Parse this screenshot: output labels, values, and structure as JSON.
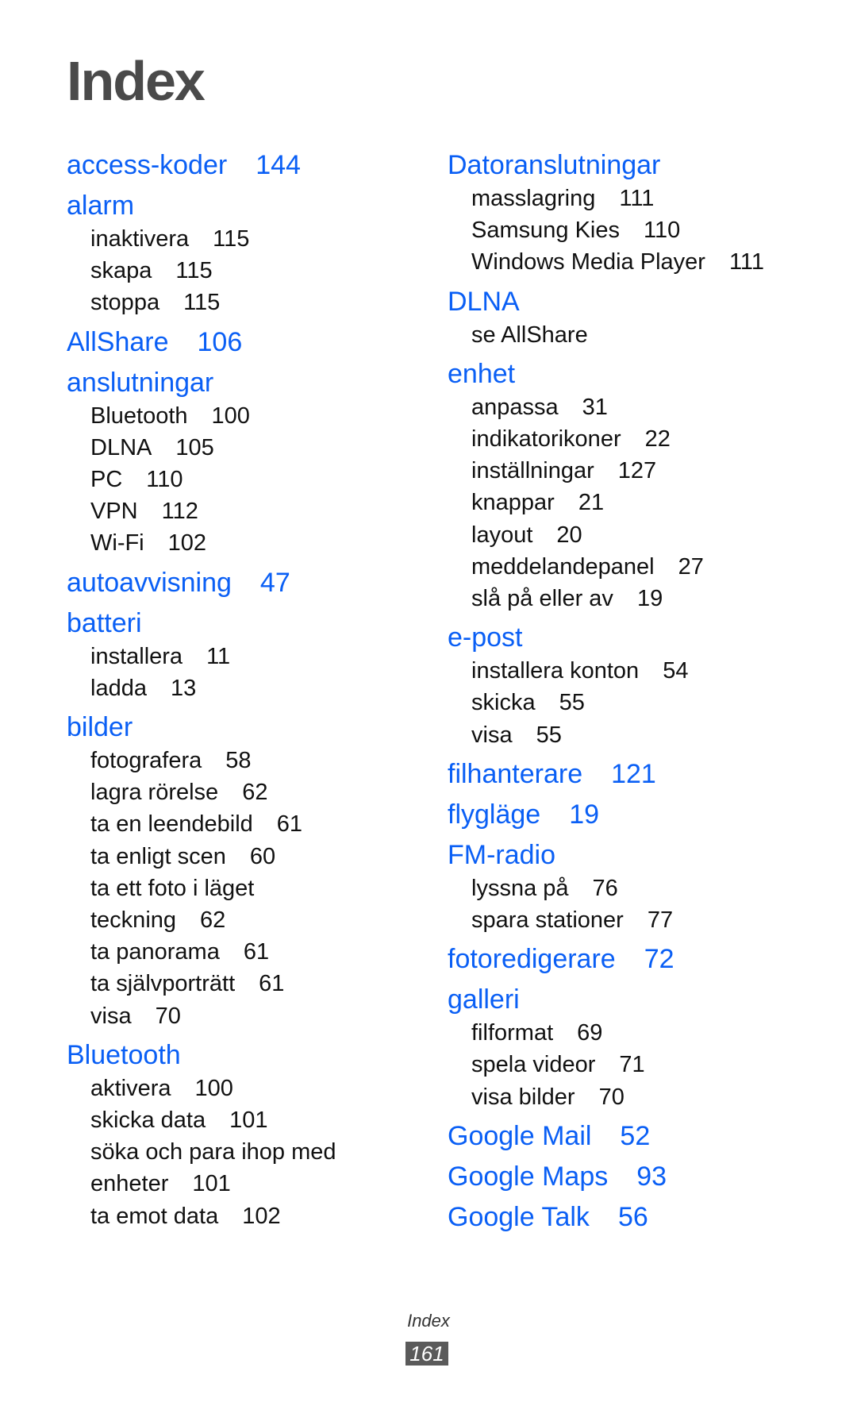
{
  "title": "Index",
  "columns": [
    {
      "entries": [
        {
          "term": "access-koder",
          "page": "144",
          "subs": []
        },
        {
          "term": "alarm",
          "page": "",
          "subs": [
            {
              "text": "inaktivera",
              "page": "115"
            },
            {
              "text": "skapa",
              "page": "115"
            },
            {
              "text": "stoppa",
              "page": "115"
            }
          ]
        },
        {
          "term": "AllShare",
          "page": "106",
          "subs": []
        },
        {
          "term": "anslutningar",
          "page": "",
          "subs": [
            {
              "text": "Bluetooth",
              "page": "100"
            },
            {
              "text": "DLNA",
              "page": "105"
            },
            {
              "text": "PC",
              "page": "110"
            },
            {
              "text": "VPN",
              "page": "112"
            },
            {
              "text": "Wi-Fi",
              "page": "102"
            }
          ]
        },
        {
          "term": "autoavvisning",
          "page": "47",
          "subs": []
        },
        {
          "term": "batteri",
          "page": "",
          "subs": [
            {
              "text": "installera",
              "page": "11"
            },
            {
              "text": "ladda",
              "page": "13"
            }
          ]
        },
        {
          "term": "bilder",
          "page": "",
          "subs": [
            {
              "text": "fotografera",
              "page": "58"
            },
            {
              "text": "lagra rörelse",
              "page": "62"
            },
            {
              "text": "ta en leendebild",
              "page": "61"
            },
            {
              "text": "ta enligt scen",
              "page": "60"
            },
            {
              "text": "ta ett foto i läget",
              "cont": "teckning",
              "page": "62"
            },
            {
              "text": "ta panorama",
              "page": "61"
            },
            {
              "text": "ta självporträtt",
              "page": "61"
            },
            {
              "text": "visa",
              "page": "70"
            }
          ]
        },
        {
          "term": "Bluetooth",
          "page": "",
          "subs": [
            {
              "text": "aktivera",
              "page": "100"
            },
            {
              "text": "skicka data",
              "page": "101"
            },
            {
              "text": "söka och para ihop med",
              "cont": "enheter",
              "page": "101"
            },
            {
              "text": "ta emot data",
              "page": "102"
            }
          ]
        }
      ]
    },
    {
      "entries": [
        {
          "term": "Datoranslutningar",
          "page": "",
          "subs": [
            {
              "text": "masslagring",
              "page": "111"
            },
            {
              "text": "Samsung Kies",
              "page": "110"
            },
            {
              "text": "Windows Media Player",
              "page": "111"
            }
          ]
        },
        {
          "term": "DLNA",
          "page": "",
          "subs": [
            {
              "text": "se AllShare",
              "page": ""
            }
          ]
        },
        {
          "term": "enhet",
          "page": "",
          "subs": [
            {
              "text": "anpassa",
              "page": "31"
            },
            {
              "text": "indikatorikoner",
              "page": "22"
            },
            {
              "text": "inställningar",
              "page": "127"
            },
            {
              "text": "knappar",
              "page": "21"
            },
            {
              "text": "layout",
              "page": "20"
            },
            {
              "text": "meddelandepanel",
              "page": "27"
            },
            {
              "text": "slå på eller av",
              "page": "19"
            }
          ]
        },
        {
          "term": "e-post",
          "page": "",
          "subs": [
            {
              "text": "installera konton",
              "page": "54"
            },
            {
              "text": "skicka",
              "page": "55"
            },
            {
              "text": "visa",
              "page": "55"
            }
          ]
        },
        {
          "term": "filhanterare",
          "page": "121",
          "subs": []
        },
        {
          "term": "flygläge",
          "page": "19",
          "subs": []
        },
        {
          "term": "FM-radio",
          "page": "",
          "subs": [
            {
              "text": "lyssna på",
              "page": "76"
            },
            {
              "text": "spara stationer",
              "page": "77"
            }
          ]
        },
        {
          "term": "fotoredigerare",
          "page": "72",
          "subs": []
        },
        {
          "term": "galleri",
          "page": "",
          "subs": [
            {
              "text": "filformat",
              "page": "69"
            },
            {
              "text": "spela videor",
              "page": "71"
            },
            {
              "text": "visa bilder",
              "page": "70"
            }
          ]
        },
        {
          "term": "Google Mail",
          "page": "52",
          "subs": []
        },
        {
          "term": "Google Maps",
          "page": "93",
          "subs": []
        },
        {
          "term": "Google Talk",
          "page": "56",
          "subs": []
        }
      ]
    }
  ],
  "footer": {
    "section": "Index",
    "page_number": "161"
  },
  "colors": {
    "heading": "#0a5ff5",
    "text": "#111111",
    "title": "#4a4a4a",
    "page_badge": "#5a5a5a"
  }
}
